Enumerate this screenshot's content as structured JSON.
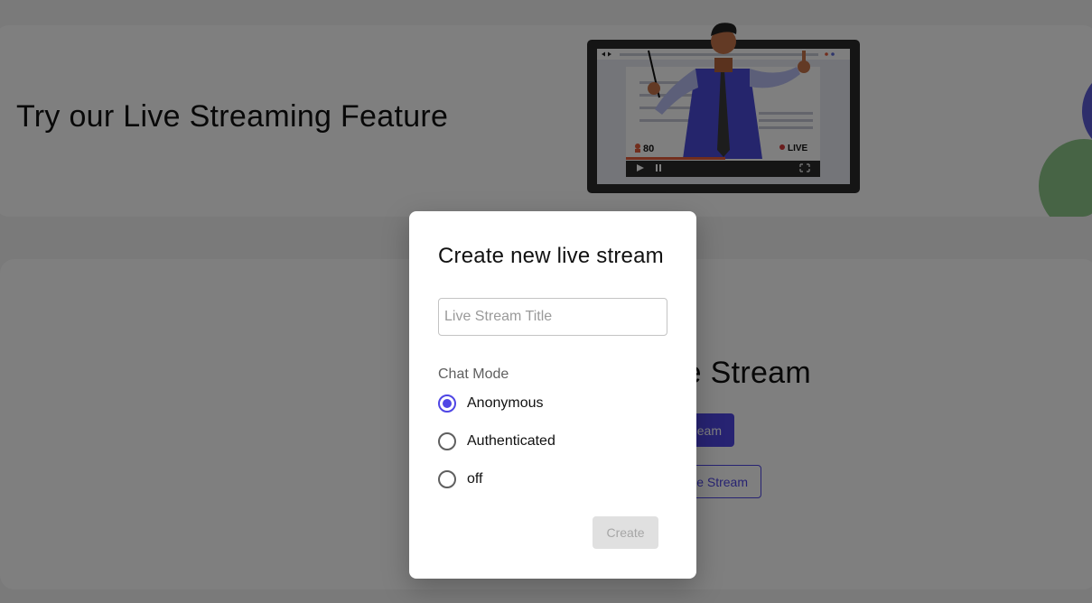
{
  "hero": {
    "title": "Try our Live Streaming Feature",
    "illustration": {
      "viewer_count": "80",
      "live_badge": "LIVE"
    }
  },
  "main": {
    "heading_visible": "e Stream",
    "go_live_button_visible": "eam",
    "join_button_visible": "e Stream"
  },
  "dialog": {
    "title": "Create new live stream",
    "title_input": {
      "placeholder": "Live Stream Title",
      "value": ""
    },
    "chat_mode_label": "Chat Mode",
    "options": [
      {
        "label": "Anonymous",
        "selected": true
      },
      {
        "label": "Authenticated",
        "selected": false
      },
      {
        "label": "off",
        "selected": false
      }
    ],
    "create_button": "Create",
    "create_enabled": false
  },
  "colors": {
    "accent": "#4f46e5",
    "overlay": "rgba(0,0,0,0.5)"
  }
}
